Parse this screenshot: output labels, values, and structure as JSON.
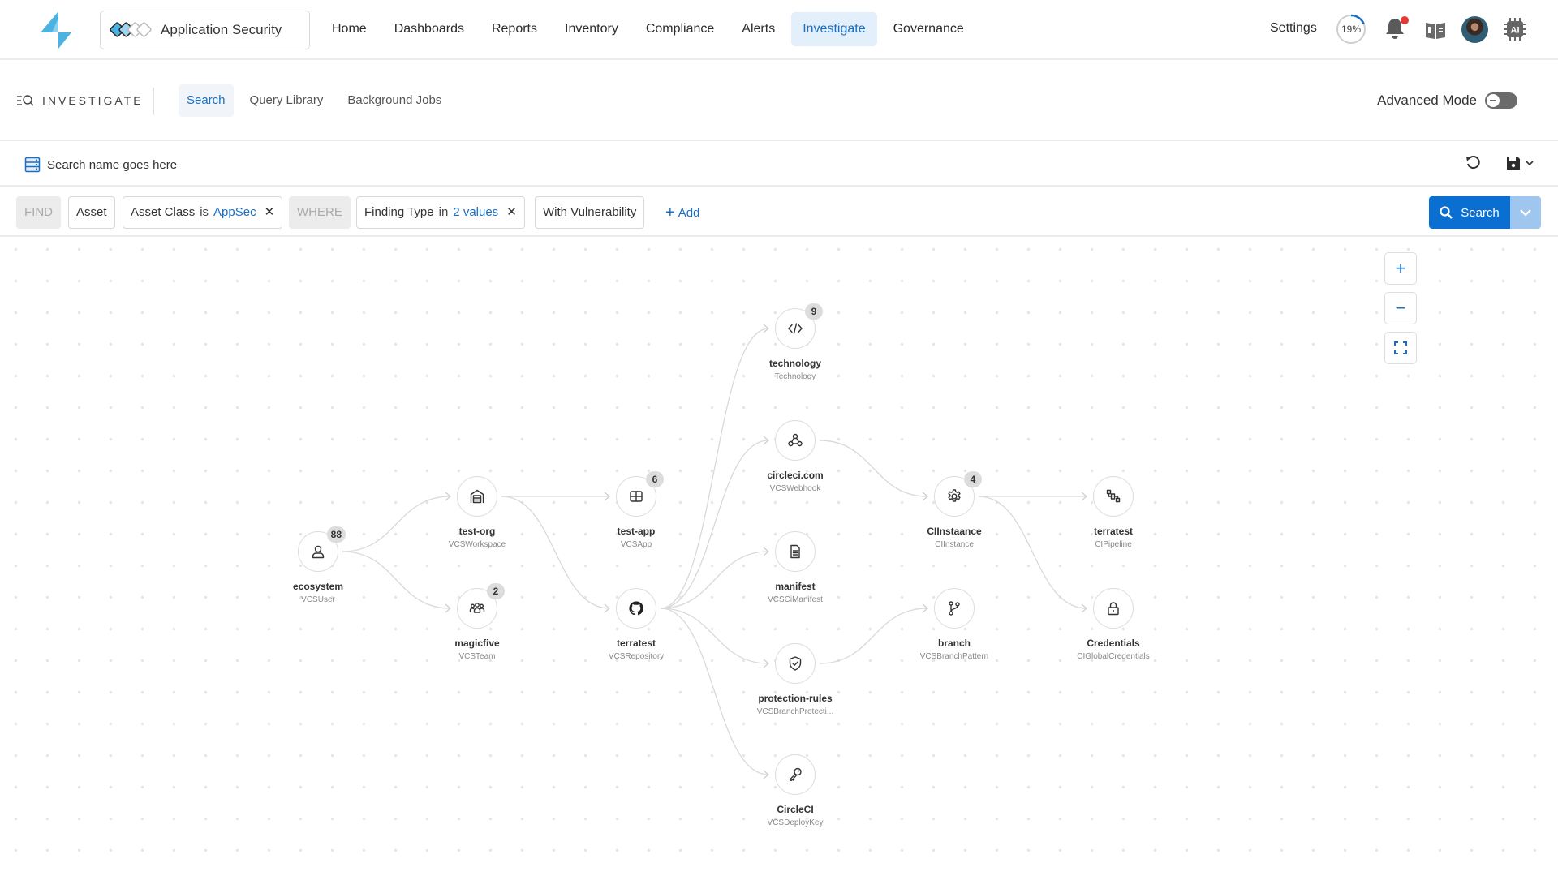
{
  "app": {
    "product_name": "Application Security",
    "brand_color": "#4ab3e2",
    "accent_color": "#0a6fd0"
  },
  "nav": {
    "items": [
      {
        "label": "Home",
        "active": false
      },
      {
        "label": "Dashboards",
        "active": false
      },
      {
        "label": "Reports",
        "active": false
      },
      {
        "label": "Inventory",
        "active": false
      },
      {
        "label": "Compliance",
        "active": false
      },
      {
        "label": "Alerts",
        "active": false
      },
      {
        "label": "Investigate",
        "active": true
      },
      {
        "label": "Governance",
        "active": false
      }
    ],
    "settings_label": "Settings",
    "progress_percent": 19,
    "progress_label": "19%",
    "notifications_unread": true
  },
  "subheader": {
    "section_title": "INVESTIGATE",
    "tabs": [
      {
        "label": "Search",
        "active": true
      },
      {
        "label": "Query Library",
        "active": false
      },
      {
        "label": "Background Jobs",
        "active": false
      }
    ],
    "advanced_mode_label": "Advanced Mode",
    "advanced_mode_on": false
  },
  "search": {
    "name": "Search name goes here"
  },
  "query": {
    "find_keyword": "FIND",
    "asset_label": "Asset",
    "filter1": {
      "field": "Asset Class",
      "op": "is",
      "value": "AppSec"
    },
    "where_keyword": "WHERE",
    "filter2": {
      "field": "Finding Type",
      "op": "in",
      "value": "2 values"
    },
    "with_label": "With Vulnerability",
    "add_label": "Add",
    "search_button_label": "Search"
  },
  "graph": {
    "nodes": [
      {
        "id": "ecosystem",
        "name": "ecosystem",
        "type": "VCSUser",
        "icon": "user-icon",
        "count": "88"
      },
      {
        "id": "test-org",
        "name": "test-org",
        "type": "VCSWorkspace",
        "icon": "warehouse-icon",
        "count": null
      },
      {
        "id": "magicfive",
        "name": "magicfive",
        "type": "VCSTeam",
        "icon": "team-icon",
        "count": "2"
      },
      {
        "id": "test-app",
        "name": "test-app",
        "type": "VCSApp",
        "icon": "app-grid-icon",
        "count": "6"
      },
      {
        "id": "terratest-repo",
        "name": "terratest",
        "type": "VCSRepository",
        "icon": "github-icon",
        "count": null
      },
      {
        "id": "technology",
        "name": "technology",
        "type": "Technology",
        "icon": "code-icon",
        "count": "9"
      },
      {
        "id": "circleci-com",
        "name": "circleci.com",
        "type": "VCSWebhook",
        "icon": "webhook-icon",
        "count": null
      },
      {
        "id": "manifest",
        "name": "manifest",
        "type": "VCSCiManifest",
        "icon": "document-icon",
        "count": null
      },
      {
        "id": "protection-rules",
        "name": "protection-rules",
        "type": "VCSBranchProtecti...",
        "icon": "shield-check-icon",
        "count": null
      },
      {
        "id": "circleci-key",
        "name": "CircleCI",
        "type": "VCSDeployKey",
        "icon": "key-icon",
        "count": null
      },
      {
        "id": "ciinstance",
        "name": "CIInstaance",
        "type": "CIInstance",
        "icon": "gear-icon",
        "count": "4"
      },
      {
        "id": "branch",
        "name": "branch",
        "type": "VCSBranchPattern",
        "icon": "branch-icon",
        "count": null
      },
      {
        "id": "terratest-pipeline",
        "name": "terratest",
        "type": "CIPipeline",
        "icon": "pipeline-icon",
        "count": null
      },
      {
        "id": "credentials",
        "name": "Credentials",
        "type": "CIGlobalCredentials",
        "icon": "lock-icon",
        "count": null
      }
    ],
    "edges": [
      [
        "ecosystem",
        "test-org"
      ],
      [
        "ecosystem",
        "magicfive"
      ],
      [
        "test-org",
        "test-app"
      ],
      [
        "test-org",
        "terratest-repo"
      ],
      [
        "terratest-repo",
        "technology"
      ],
      [
        "terratest-repo",
        "circleci-com"
      ],
      [
        "terratest-repo",
        "manifest"
      ],
      [
        "terratest-repo",
        "protection-rules"
      ],
      [
        "terratest-repo",
        "circleci-key"
      ],
      [
        "circleci-com",
        "ciinstance"
      ],
      [
        "protection-rules",
        "branch"
      ],
      [
        "ciinstance",
        "terratest-pipeline"
      ],
      [
        "ciinstance",
        "credentials"
      ]
    ]
  }
}
